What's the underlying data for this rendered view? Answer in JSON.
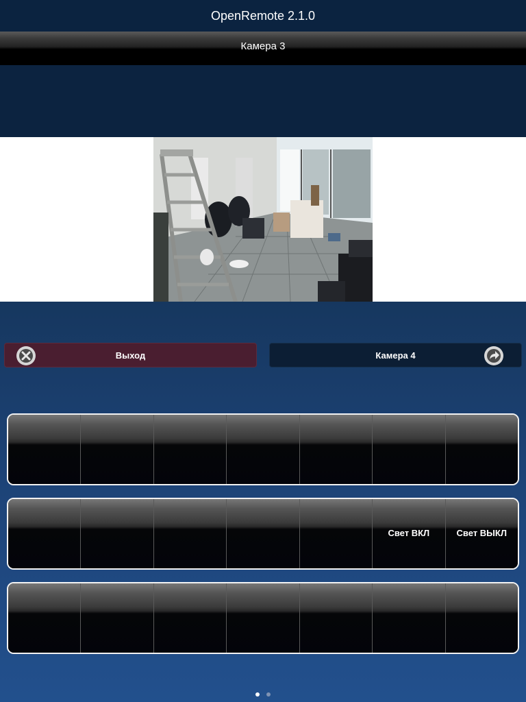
{
  "app": {
    "title": "OpenRemote 2.1.0"
  },
  "camera": {
    "name": "Камера 3"
  },
  "buttons": {
    "exit_label": "Выход",
    "exit_icon": "close-icon",
    "next_label": "Камера 4",
    "next_icon": "forward-arrow-icon"
  },
  "panels": [
    {
      "cells": [
        "",
        "",
        "",
        "",
        "",
        "",
        ""
      ]
    },
    {
      "cells": [
        "",
        "",
        "",
        "",
        "",
        "Свет ВКЛ",
        "Свет ВЫКЛ"
      ]
    },
    {
      "cells": [
        "",
        "",
        "",
        "",
        "",
        "",
        ""
      ]
    }
  ],
  "pagination": {
    "total": 2,
    "active": 1
  },
  "colors": {
    "header_bg": "#0b2340",
    "exit_button_bg": "#4a1e30",
    "next_button_bg": "#0c1e34"
  }
}
